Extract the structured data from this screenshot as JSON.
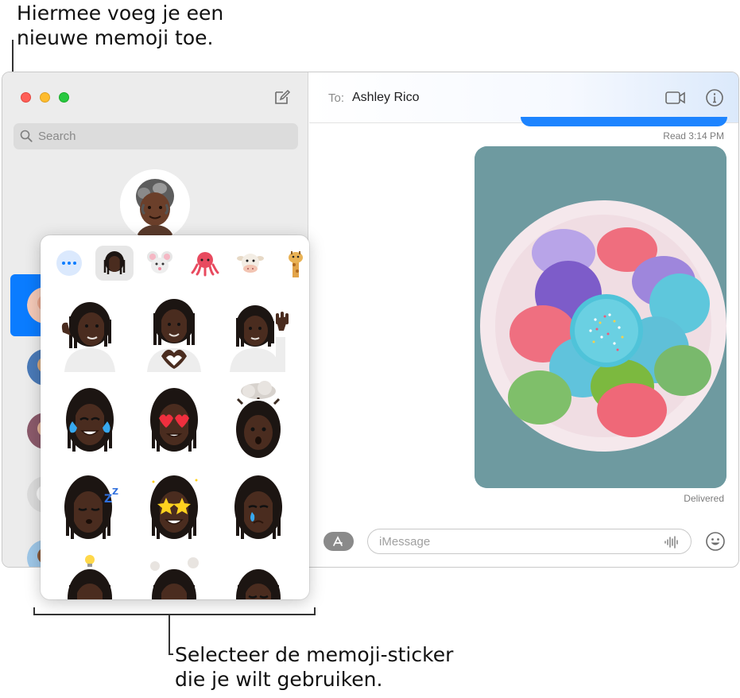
{
  "annotations": {
    "top_line1": "Hiermee voeg je een",
    "top_line2": "nieuwe memoji toe.",
    "bottom_line1": "Selecteer de memoji-sticker",
    "bottom_line2": "die je wilt gebruiken."
  },
  "sidebar": {
    "search_placeholder": "Search"
  },
  "conversation": {
    "to_label": "To:",
    "recipient": "Ashley Rico",
    "read_receipt": "Read 3:14 PM",
    "delivery_status": "Delivered"
  },
  "composer": {
    "placeholder": "iMessage"
  },
  "sticker_panel": {
    "tabs": [
      {
        "icon": "more-icon"
      },
      {
        "icon": "memoji-icon",
        "selected": true
      },
      {
        "icon": "mouse-icon"
      },
      {
        "icon": "octopus-icon"
      },
      {
        "icon": "cow-icon"
      },
      {
        "icon": "giraffe-icon"
      }
    ],
    "stickers": [
      "call-me-memoji",
      "heart-hands-memoji",
      "wave-memoji",
      "tears-of-joy-memoji",
      "heart-eyes-memoji",
      "mind-blown-memoji",
      "sleeping-memoji",
      "star-struck-memoji",
      "crying-memoji",
      "idea-memoji",
      "cloudy-memoji",
      "sneezing-memoji"
    ]
  },
  "colors": {
    "accent": "#0a7cff",
    "sidebar_bg": "#ececec",
    "bubble_blue": "#1d84ff"
  }
}
